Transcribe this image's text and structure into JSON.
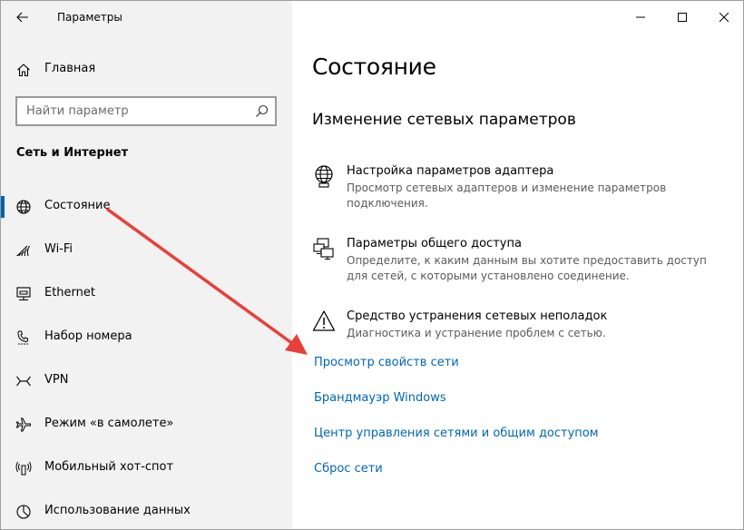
{
  "window": {
    "title": "Параметры"
  },
  "sidebar": {
    "home_label": "Главная",
    "search_placeholder": "Найти параметр",
    "section_title": "Сеть и Интернет",
    "items": [
      {
        "label": "Состояние",
        "icon": "globe-icon",
        "selected": true
      },
      {
        "label": "Wi-Fi",
        "icon": "wifi-icon",
        "selected": false
      },
      {
        "label": "Ethernet",
        "icon": "ethernet-icon",
        "selected": false
      },
      {
        "label": "Набор номера",
        "icon": "dialup-icon",
        "selected": false
      },
      {
        "label": "VPN",
        "icon": "vpn-icon",
        "selected": false
      },
      {
        "label": "Режим «в самолете»",
        "icon": "airplane-icon",
        "selected": false
      },
      {
        "label": "Мобильный хот-спот",
        "icon": "hotspot-icon",
        "selected": false
      },
      {
        "label": "Использование данных",
        "icon": "data-usage-icon",
        "selected": false
      }
    ]
  },
  "main": {
    "title": "Состояние",
    "subtitle": "Изменение сетевых параметров",
    "options": [
      {
        "title": "Настройка параметров адаптера",
        "desc": "Просмотр сетевых адаптеров и изменение параметров подключения.",
        "icon": "globe-adapter-icon"
      },
      {
        "title": "Параметры общего доступа",
        "desc": "Определите, к каким данным вы хотите предоставить доступ для сетей, с которыми установлено соединение.",
        "icon": "sharing-icon"
      },
      {
        "title": "Средство устранения сетевых неполадок",
        "desc": "Диагностика и устранение проблем с сетью.",
        "icon": "warning-icon"
      }
    ],
    "links": [
      "Просмотр свойств сети",
      "Брандмауэр Windows",
      "Центр управления сетями и общим доступом",
      "Сброс сети"
    ]
  },
  "colors": {
    "accent": "#0063b1",
    "link": "#0066b4",
    "arrow": "#e8403a",
    "sidebar_bg": "#f2f2f2"
  }
}
